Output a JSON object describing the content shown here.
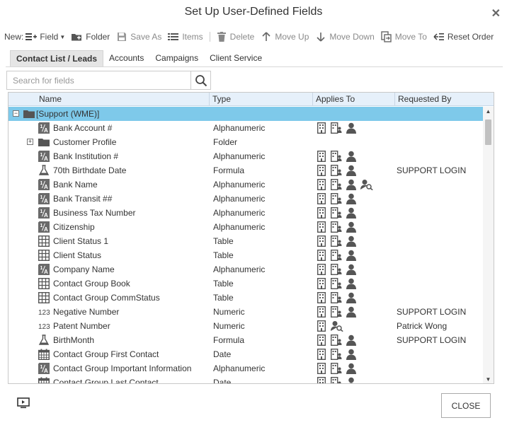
{
  "dialog": {
    "title": "Set Up User-Defined Fields"
  },
  "toolbar": {
    "new_label": "New:",
    "field_label": "Field",
    "folder_label": "Folder",
    "save_as_label": "Save As",
    "items_label": "Items",
    "delete_label": "Delete",
    "move_up_label": "Move Up",
    "move_down_label": "Move Down",
    "move_to_label": "Move To",
    "reset_order_label": "Reset Order"
  },
  "tabs": [
    {
      "label": "Contact List / Leads",
      "active": true
    },
    {
      "label": "Accounts",
      "active": false
    },
    {
      "label": "Campaigns",
      "active": false
    },
    {
      "label": "Client Service",
      "active": false
    }
  ],
  "search": {
    "placeholder": "Search for fields",
    "value": ""
  },
  "grid": {
    "columns": {
      "name": "Name",
      "type": "Type",
      "applies_to": "Applies To",
      "requested_by": "Requested By"
    },
    "rows": [
      {
        "name": "[Support (WME)]",
        "type": "",
        "requested_by": "",
        "icon": "folder-icon",
        "expander": "-",
        "level": 0,
        "selected": true,
        "applies": []
      },
      {
        "name": "Bank Account #",
        "type": "Alphanumeric",
        "requested_by": "",
        "icon": "alphanumeric-icon",
        "expander": "",
        "level": 1,
        "applies": [
          "building-icon",
          "company-people-icon",
          "person-icon"
        ]
      },
      {
        "name": "Customer Profile",
        "type": "Folder",
        "requested_by": "",
        "icon": "folder-icon",
        "expander": "+",
        "level": 1,
        "applies": []
      },
      {
        "name": "Bank Institution #",
        "type": "Alphanumeric",
        "requested_by": "",
        "icon": "alphanumeric-icon",
        "expander": "",
        "level": 1,
        "applies": [
          "building-icon",
          "company-people-icon",
          "person-icon"
        ]
      },
      {
        "name": "70th Birthdate Date",
        "type": "Formula",
        "requested_by": "SUPPORT LOGIN",
        "icon": "formula-flask-icon",
        "expander": "",
        "level": 1,
        "applies": [
          "building-icon",
          "company-people-icon",
          "person-icon"
        ]
      },
      {
        "name": "Bank Name",
        "type": "Alphanumeric",
        "requested_by": "",
        "icon": "alphanumeric-icon",
        "expander": "",
        "level": 1,
        "applies": [
          "building-icon",
          "company-people-icon",
          "person-icon",
          "person-search-icon"
        ]
      },
      {
        "name": "Bank Transit ##",
        "type": "Alphanumeric",
        "requested_by": "",
        "icon": "alphanumeric-icon",
        "expander": "",
        "level": 1,
        "applies": [
          "building-icon",
          "company-people-icon",
          "person-icon"
        ]
      },
      {
        "name": "Business Tax Number",
        "type": "Alphanumeric",
        "requested_by": "",
        "icon": "alphanumeric-icon",
        "expander": "",
        "level": 1,
        "applies": [
          "building-icon",
          "company-people-icon",
          "person-icon"
        ]
      },
      {
        "name": "Citizenship",
        "type": "Alphanumeric",
        "requested_by": "",
        "icon": "alphanumeric-icon",
        "expander": "",
        "level": 1,
        "applies": [
          "building-icon",
          "company-people-icon",
          "person-icon"
        ]
      },
      {
        "name": "Client Status 1",
        "type": "Table",
        "requested_by": "",
        "icon": "table-icon",
        "expander": "",
        "level": 1,
        "applies": [
          "building-icon",
          "company-people-icon",
          "person-icon"
        ]
      },
      {
        "name": "Client Status",
        "type": "Table",
        "requested_by": "",
        "icon": "table-icon",
        "expander": "",
        "level": 1,
        "applies": [
          "building-icon",
          "company-people-icon",
          "person-icon"
        ]
      },
      {
        "name": "Company Name",
        "type": "Alphanumeric",
        "requested_by": "",
        "icon": "alphanumeric-icon",
        "expander": "",
        "level": 1,
        "applies": [
          "building-icon",
          "company-people-icon",
          "person-icon"
        ]
      },
      {
        "name": "Contact Group Book",
        "type": "Table",
        "requested_by": "",
        "icon": "table-icon",
        "expander": "",
        "level": 1,
        "applies": [
          "building-icon",
          "company-people-icon",
          "person-icon"
        ]
      },
      {
        "name": "Contact Group CommStatus",
        "type": "Table",
        "requested_by": "",
        "icon": "table-icon",
        "expander": "",
        "level": 1,
        "applies": [
          "building-icon",
          "company-people-icon",
          "person-icon"
        ]
      },
      {
        "name": "Negative Number",
        "type": "Numeric",
        "requested_by": "SUPPORT LOGIN",
        "icon": "numeric-icon",
        "expander": "",
        "level": 1,
        "applies": [
          "building-icon",
          "company-people-icon",
          "person-icon"
        ]
      },
      {
        "name": "Patent Number",
        "type": "Numeric",
        "requested_by": "Patrick Wong",
        "icon": "numeric-icon",
        "expander": "",
        "level": 1,
        "applies": [
          "building-icon",
          "person-search-icon"
        ]
      },
      {
        "name": "BirthMonth",
        "type": "Formula",
        "requested_by": "SUPPORT LOGIN",
        "icon": "formula-flask-icon",
        "expander": "",
        "level": 1,
        "applies": [
          "building-icon",
          "company-people-icon",
          "person-icon"
        ]
      },
      {
        "name": "Contact Group First Contact",
        "type": "Date",
        "requested_by": "",
        "icon": "calendar-icon",
        "expander": "",
        "level": 1,
        "applies": [
          "building-icon",
          "company-people-icon",
          "person-icon"
        ]
      },
      {
        "name": "Contact Group Important Information",
        "type": "Alphanumeric",
        "requested_by": "",
        "icon": "alphanumeric-icon",
        "expander": "",
        "level": 1,
        "applies": [
          "building-icon",
          "company-people-icon",
          "person-icon"
        ]
      },
      {
        "name": "Contact Group Last Contact",
        "type": "Date",
        "requested_by": "",
        "icon": "calendar-icon",
        "expander": "",
        "level": 1,
        "applies": [
          "building-icon",
          "company-people-icon",
          "person-icon"
        ]
      }
    ]
  },
  "footer": {
    "close_label": "CLOSE",
    "screen_icon": "screen-icon"
  },
  "colors": {
    "selected_row": "#7ec9ea",
    "header_bg": "#e6f0fa",
    "icon_gray": "#555555"
  }
}
